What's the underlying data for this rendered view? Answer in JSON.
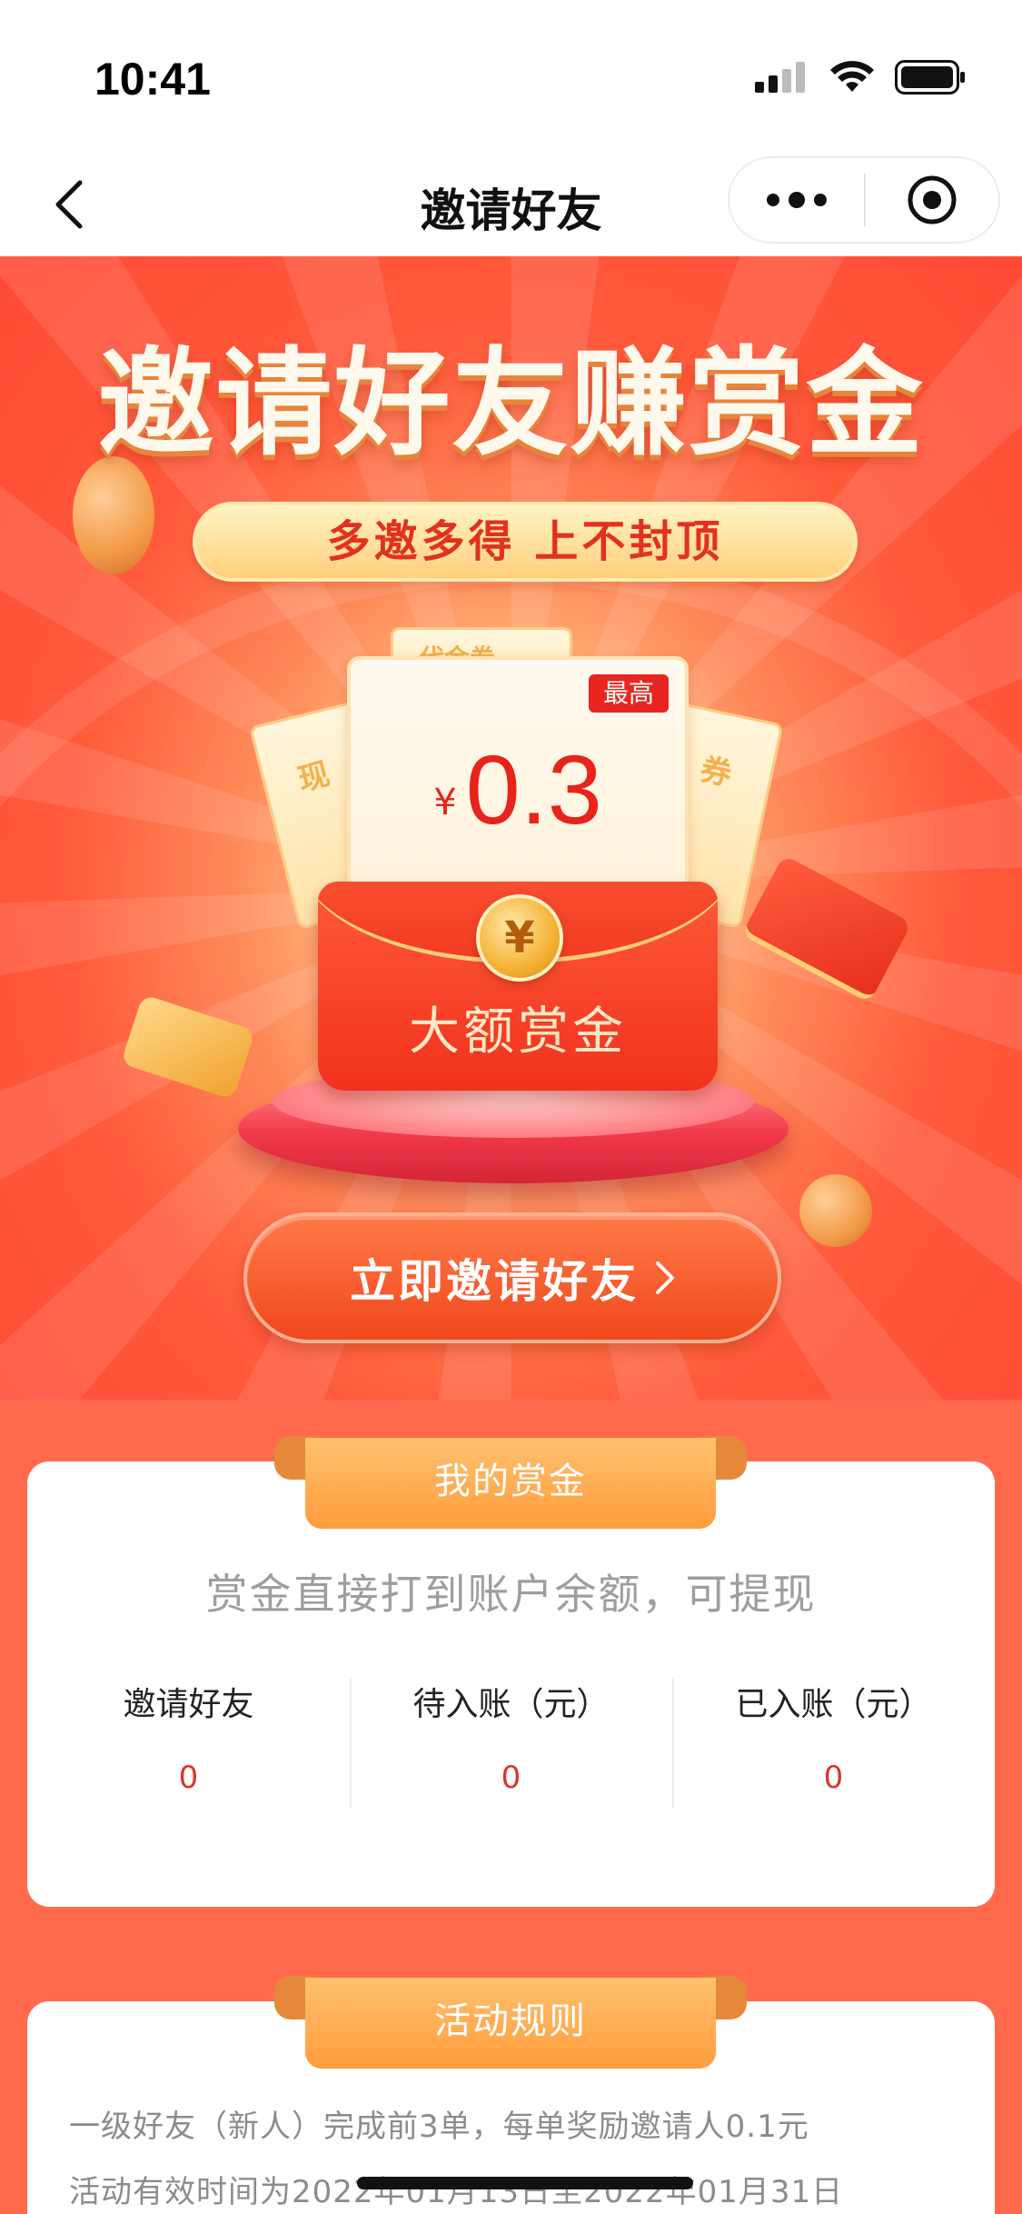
{
  "status_bar": {
    "time": "10:41"
  },
  "nav": {
    "title": "邀请好友"
  },
  "hero": {
    "title": "邀请好友赚赏金",
    "slogan": "多邀多得 上不封顶",
    "coupon": {
      "badge": "最高",
      "currency": "¥",
      "amount": "0.3"
    },
    "ticket_left": "现",
    "ticket_right": "券",
    "ticket_back": "代金券",
    "coin_symbol": "¥",
    "envelope_label": "大额赏金",
    "invite_button": "立即邀请好友"
  },
  "reward": {
    "ribbon": "我的赏金",
    "subtitle": "赏金直接打到账户余额，可提现",
    "stats": [
      {
        "label": "邀请好友",
        "value": "0"
      },
      {
        "label": "待入账（元）",
        "value": "0"
      },
      {
        "label": "已入账（元）",
        "value": "0"
      }
    ]
  },
  "rules": {
    "ribbon": "活动规则",
    "lines": [
      "一级好友（新人）完成前3单，每单奖励邀请人0.1元",
      "活动有效时间为2022年01月13日至2022年01月31日"
    ]
  },
  "colors": {
    "accent": "#ff5a3c",
    "button": "#f0481c",
    "ribbon": "#ff9d3c",
    "value_red": "#d9362b"
  }
}
